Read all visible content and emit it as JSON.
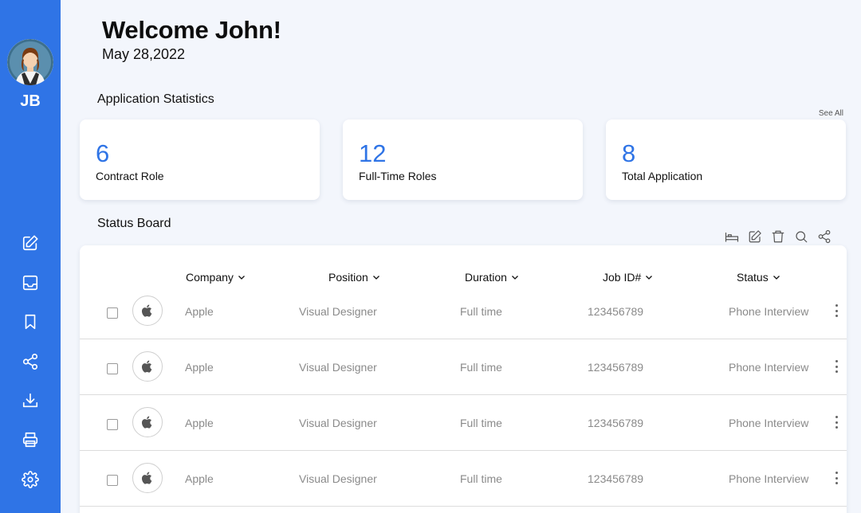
{
  "user": {
    "initials": "JB"
  },
  "header": {
    "title": "Welcome John!",
    "date": "May 28,2022"
  },
  "stats": {
    "section_title": "Application Statistics",
    "see_all": "See All",
    "cards": [
      {
        "value": "6",
        "label": "Contract Role"
      },
      {
        "value": "12",
        "label": "Full-Time Roles"
      },
      {
        "value": "8",
        "label": "Total Application"
      }
    ]
  },
  "board": {
    "section_title": "Status Board",
    "columns": [
      "Company",
      "Position",
      "Duration",
      "Job ID#",
      "Status"
    ],
    "rows": [
      {
        "company": "Apple",
        "position": "Visual Designer",
        "duration": "Full time",
        "job_id": "123456789",
        "status": "Phone Interview"
      },
      {
        "company": "Apple",
        "position": "Visual Designer",
        "duration": "Full time",
        "job_id": "123456789",
        "status": "Phone Interview"
      },
      {
        "company": "Apple",
        "position": "Visual Designer",
        "duration": "Full time",
        "job_id": "123456789",
        "status": "Phone Interview"
      },
      {
        "company": "Apple",
        "position": "Visual Designer",
        "duration": "Full time",
        "job_id": "123456789",
        "status": "Phone Interview"
      }
    ]
  },
  "icons": {
    "sidebar": [
      "edit-icon",
      "inbox-icon",
      "bookmark-icon",
      "share-icon",
      "download-icon",
      "print-icon",
      "settings-icon"
    ],
    "toolbar": [
      "bed-icon",
      "edit-icon",
      "trash-icon",
      "search-icon",
      "share-icon"
    ]
  },
  "colors": {
    "accent": "#2f74e6",
    "background": "#f3f6fc"
  }
}
